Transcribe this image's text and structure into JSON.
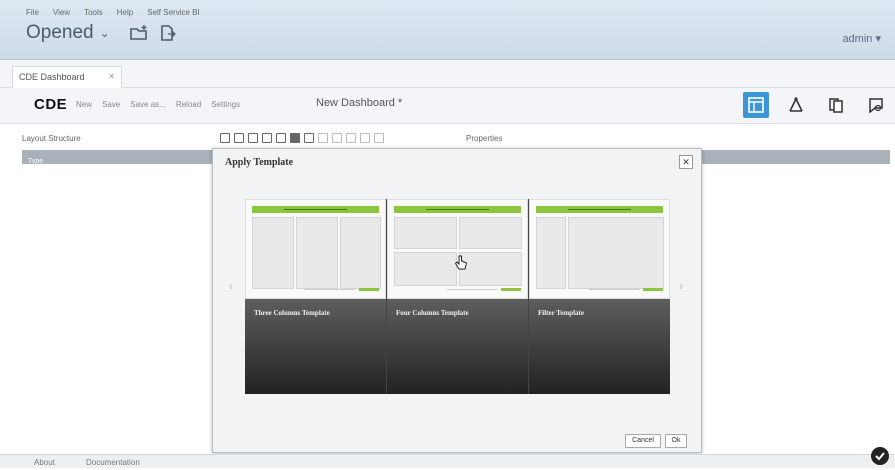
{
  "menu": [
    "File",
    "View",
    "Tools",
    "Help",
    "Self Service BI"
  ],
  "top": {
    "opened_label": "Opened",
    "user_label": "admin"
  },
  "tab": {
    "label": "CDE Dashboard"
  },
  "toolbar": {
    "logo": "CDE",
    "buttons": [
      "New",
      "Save",
      "Save as...",
      "Reload",
      "Settings"
    ],
    "dashboard_name": "New Dashboard *"
  },
  "layout_panel": {
    "title": "Layout Structure",
    "type_col": "Type",
    "properties_label": "Properties"
  },
  "modal": {
    "title": "Apply Template",
    "templates": [
      {
        "name": "Three Columns Template"
      },
      {
        "name": "Four Columns Template"
      },
      {
        "name": "Filter Template"
      }
    ],
    "cancel_label": "Cancel",
    "ok_label": "Ok"
  },
  "footer": {
    "about": "About",
    "documentation": "Documentation"
  }
}
